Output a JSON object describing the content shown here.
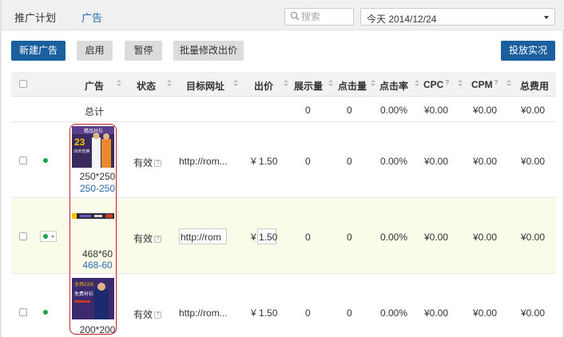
{
  "topbar": {
    "crumbs": [
      "推广计划",
      "广告"
    ],
    "search_placeholder": "搜索",
    "date_range": "今天 2014/12/24"
  },
  "toolbar": {
    "new_ad": "新建广告",
    "enable": "启用",
    "pause": "暂停",
    "batch_bid": "批量修改出价",
    "stats": "投放实况"
  },
  "table": {
    "columns": [
      "广告",
      "状态",
      "目标网址",
      "出价",
      "展示量",
      "点击量",
      "点击率",
      "CPC",
      "CPM",
      "总费用"
    ],
    "help_mark": "?",
    "total": {
      "label": "总计",
      "impressions": "0",
      "clicks": "0",
      "ctr": "0.00%",
      "cpc": "¥0.00",
      "cpm": "¥0.00",
      "cost": "¥0.00"
    },
    "rows": [
      {
        "size": "250*250",
        "link": "250-250",
        "status": "有效",
        "url": "http://rom...",
        "bid": "¥ 1.50",
        "impressions": "0",
        "clicks": "0",
        "ctr": "0.00%",
        "cpc": "¥0.00",
        "cpm": "¥0.00",
        "cost": "¥0.00",
        "thumb": {
          "brand": "精品衬衫",
          "num": "23",
          "text": "30天包换"
        }
      },
      {
        "size": "468*60",
        "link": "468-60",
        "status": "有效",
        "url": "http://rom",
        "bid_prefix": "¥",
        "bid": "1.50",
        "impressions": "0",
        "clicks": "0",
        "ctr": "0.00%",
        "cpc": "¥0.00",
        "cpm": "¥0.00",
        "cost": "¥0.00"
      },
      {
        "size": "200*200",
        "status": "有效",
        "url": "http://rom...",
        "bid": "¥ 1.50",
        "impressions": "0",
        "clicks": "0",
        "ctr": "0.00%",
        "cpc": "¥0.00",
        "cpm": "¥0.00",
        "cost": "¥0.00",
        "thumb": {
          "top": "全场23元",
          "mid": "免费衬衫"
        }
      }
    ]
  },
  "colors": {
    "primary": "#1b5f9e",
    "link": "#2a6aad",
    "status_active": "#1ea34a",
    "highlight_row": "#fbfbea",
    "outline": "#c81e2a"
  },
  "icons": [
    "search-icon",
    "sort-icon",
    "status-dot-icon",
    "help-icon",
    "dropdown-caret-icon"
  ]
}
